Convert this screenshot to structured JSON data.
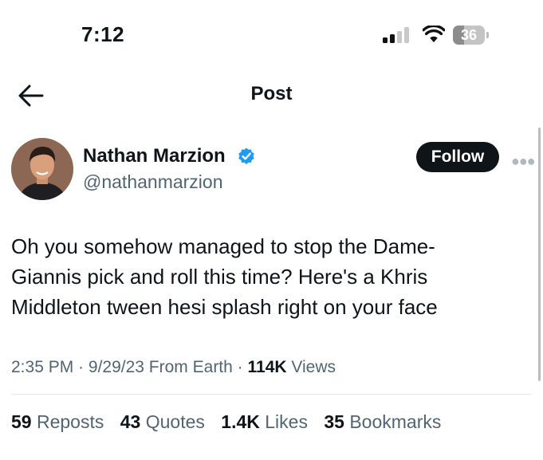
{
  "status_bar": {
    "time": "7:12",
    "battery_level": "36",
    "battery_fraction": 0.36
  },
  "header": {
    "title": "Post",
    "back_icon": "arrow-left-icon"
  },
  "author": {
    "name": "Nathan Marzion",
    "handle": "@nathanmarzion",
    "verified": true,
    "verified_color": "#1d9bf0"
  },
  "follow_label": "Follow",
  "more_icon": "more-horizontal-icon",
  "tweet": {
    "text": "Oh you somehow managed to stop the Dame-\nGiannis pick and roll this time? Here's a Khris\nMiddleton tween hesi splash right on your face"
  },
  "meta": {
    "time": "2:35 PM",
    "sep1": " · ",
    "date": "9/29/23",
    "location": " From Earth",
    "sep2": " · ",
    "views_count": "114K",
    "views_label": " Views"
  },
  "stats": [
    {
      "count": "59",
      "label": " Reposts"
    },
    {
      "count": "43",
      "label": " Quotes"
    },
    {
      "count": "1.4K",
      "label": " Likes"
    },
    {
      "count": "35",
      "label": " Bookmarks"
    }
  ],
  "colors": {
    "text": "#0f1419",
    "secondary": "#536471",
    "follow_bg": "#0f1419",
    "divider": "#e6e9eb"
  }
}
